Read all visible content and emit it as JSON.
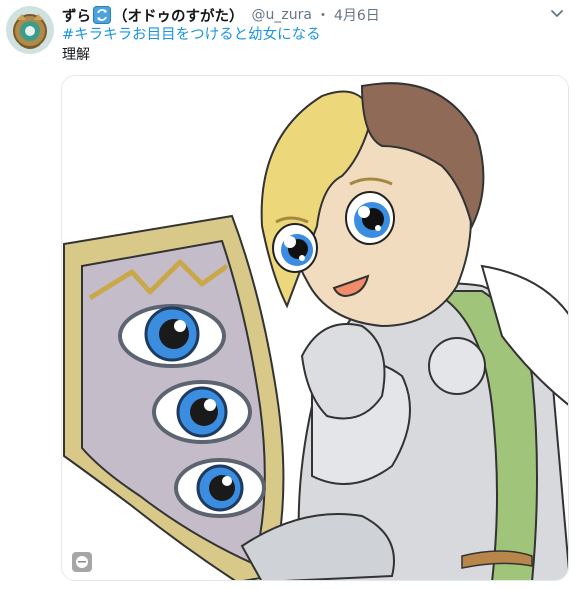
{
  "tweet": {
    "display_name": "ずら",
    "display_name_suffix": "（オドゥのすがた）",
    "handle": "@u_zura",
    "separator": "・",
    "date": "4月6日",
    "text_line1_hashtag": "#キラキラお目目をつけると幼女になる",
    "text_line2": "理解"
  },
  "icons": {
    "avatar": "avatar-image",
    "name_badge": "cycle-emoji-icon",
    "caret": "chevron-down-icon",
    "media_badge": "alt-badge-icon"
  },
  "colors": {
    "link": "#1b95e0",
    "secondary": "#657786",
    "border": "#e1e8ed"
  }
}
